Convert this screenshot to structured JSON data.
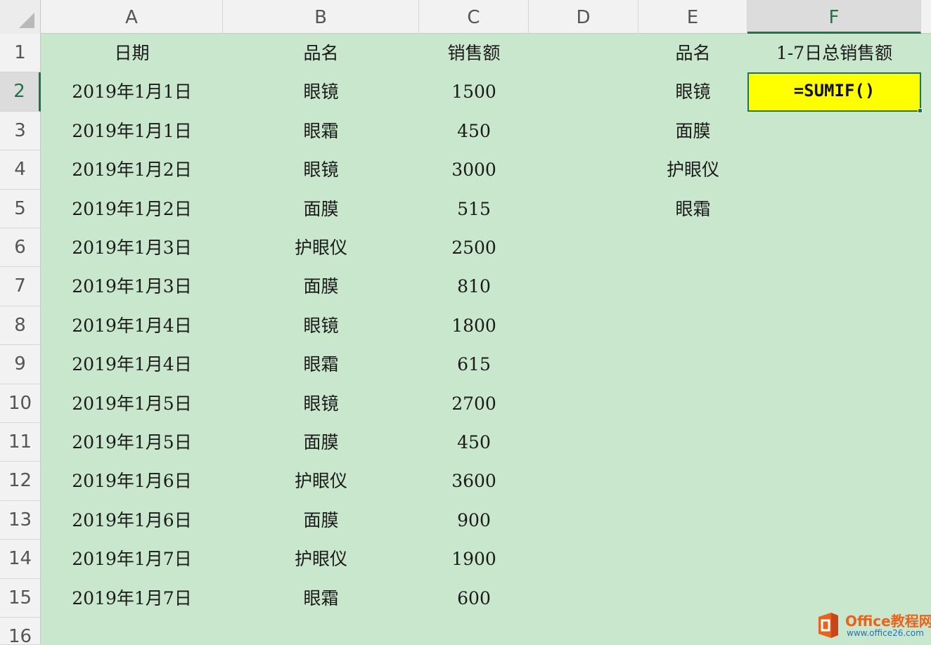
{
  "columns": [
    "A",
    "B",
    "C",
    "D",
    "E",
    "F"
  ],
  "active_column": "F",
  "active_row": 2,
  "rows": [
    "1",
    "2",
    "3",
    "4",
    "5",
    "6",
    "7",
    "8",
    "9",
    "10",
    "11",
    "12",
    "13",
    "14",
    "15",
    "16"
  ],
  "headers": {
    "date": "日期",
    "product": "品名",
    "sales": "销售额",
    "e_header": "品名",
    "f_header": "1-7日总销售额"
  },
  "data_rows": [
    {
      "date": "2019年1月1日",
      "product": "眼镜",
      "sales": "1500"
    },
    {
      "date": "2019年1月1日",
      "product": "眼霜",
      "sales": "450"
    },
    {
      "date": "2019年1月2日",
      "product": "眼镜",
      "sales": "3000"
    },
    {
      "date": "2019年1月2日",
      "product": "面膜",
      "sales": "515"
    },
    {
      "date": "2019年1月3日",
      "product": "护眼仪",
      "sales": "2500"
    },
    {
      "date": "2019年1月3日",
      "product": "面膜",
      "sales": "810"
    },
    {
      "date": "2019年1月4日",
      "product": "眼镜",
      "sales": "1800"
    },
    {
      "date": "2019年1月4日",
      "product": "眼霜",
      "sales": "615"
    },
    {
      "date": "2019年1月5日",
      "product": "眼镜",
      "sales": "2700"
    },
    {
      "date": "2019年1月5日",
      "product": "面膜",
      "sales": "450"
    },
    {
      "date": "2019年1月6日",
      "product": "护眼仪",
      "sales": "3600"
    },
    {
      "date": "2019年1月6日",
      "product": "面膜",
      "sales": "900"
    },
    {
      "date": "2019年1月7日",
      "product": "护眼仪",
      "sales": "1900"
    },
    {
      "date": "2019年1月7日",
      "product": "眼霜",
      "sales": "600"
    }
  ],
  "e_items": [
    "眼镜",
    "面膜",
    "护眼仪",
    "眼霜"
  ],
  "active_formula": "=SUMIF()",
  "colors": {
    "grid_fill": "#c9e7cc",
    "active_cell_fill": "#ffff00",
    "selection_border": "#1e7a3c"
  },
  "watermark": {
    "brand": "Office教程网",
    "url": "www.office26.com"
  }
}
